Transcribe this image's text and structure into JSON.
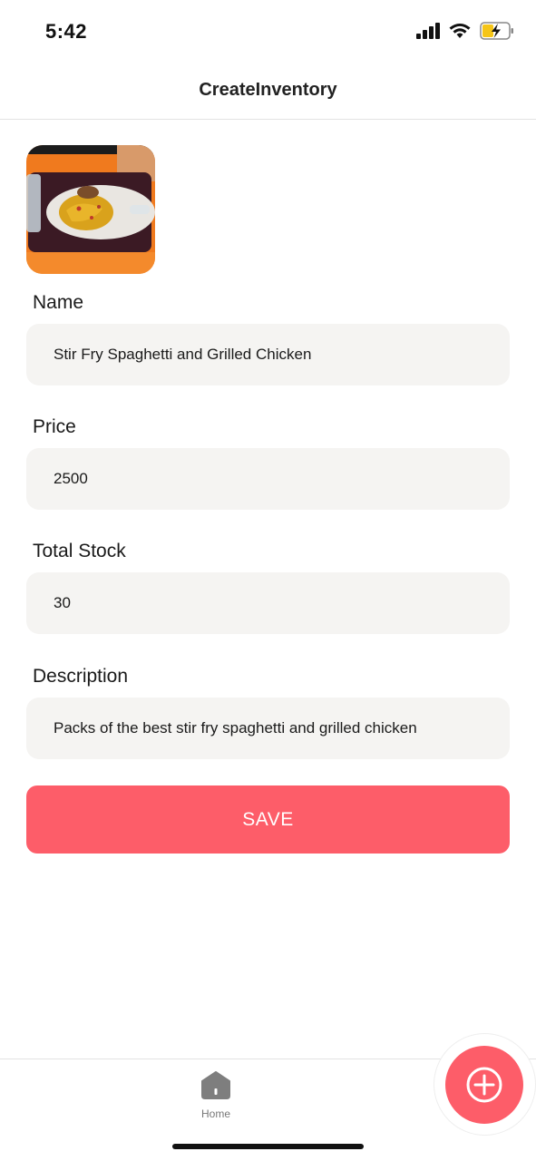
{
  "status_bar": {
    "time": "5:42"
  },
  "header": {
    "title": "CreateInventory"
  },
  "form": {
    "name": {
      "label": "Name",
      "value": "Stir Fry Spaghetti and Grilled Chicken"
    },
    "price": {
      "label": "Price",
      "value": "2500"
    },
    "stock": {
      "label": "Total Stock",
      "value": "30"
    },
    "description": {
      "label": "Description",
      "value": "Packs of the best stir fry spaghetti and grilled chicken"
    },
    "save_label": "SAVE"
  },
  "tab_bar": {
    "home_label": "Home"
  },
  "colors": {
    "accent": "#fd5d69",
    "field_bg": "#f5f4f2"
  },
  "icons": [
    "signal-icon",
    "wifi-icon",
    "battery-icon",
    "home-icon",
    "plus-icon",
    "food-photo"
  ]
}
